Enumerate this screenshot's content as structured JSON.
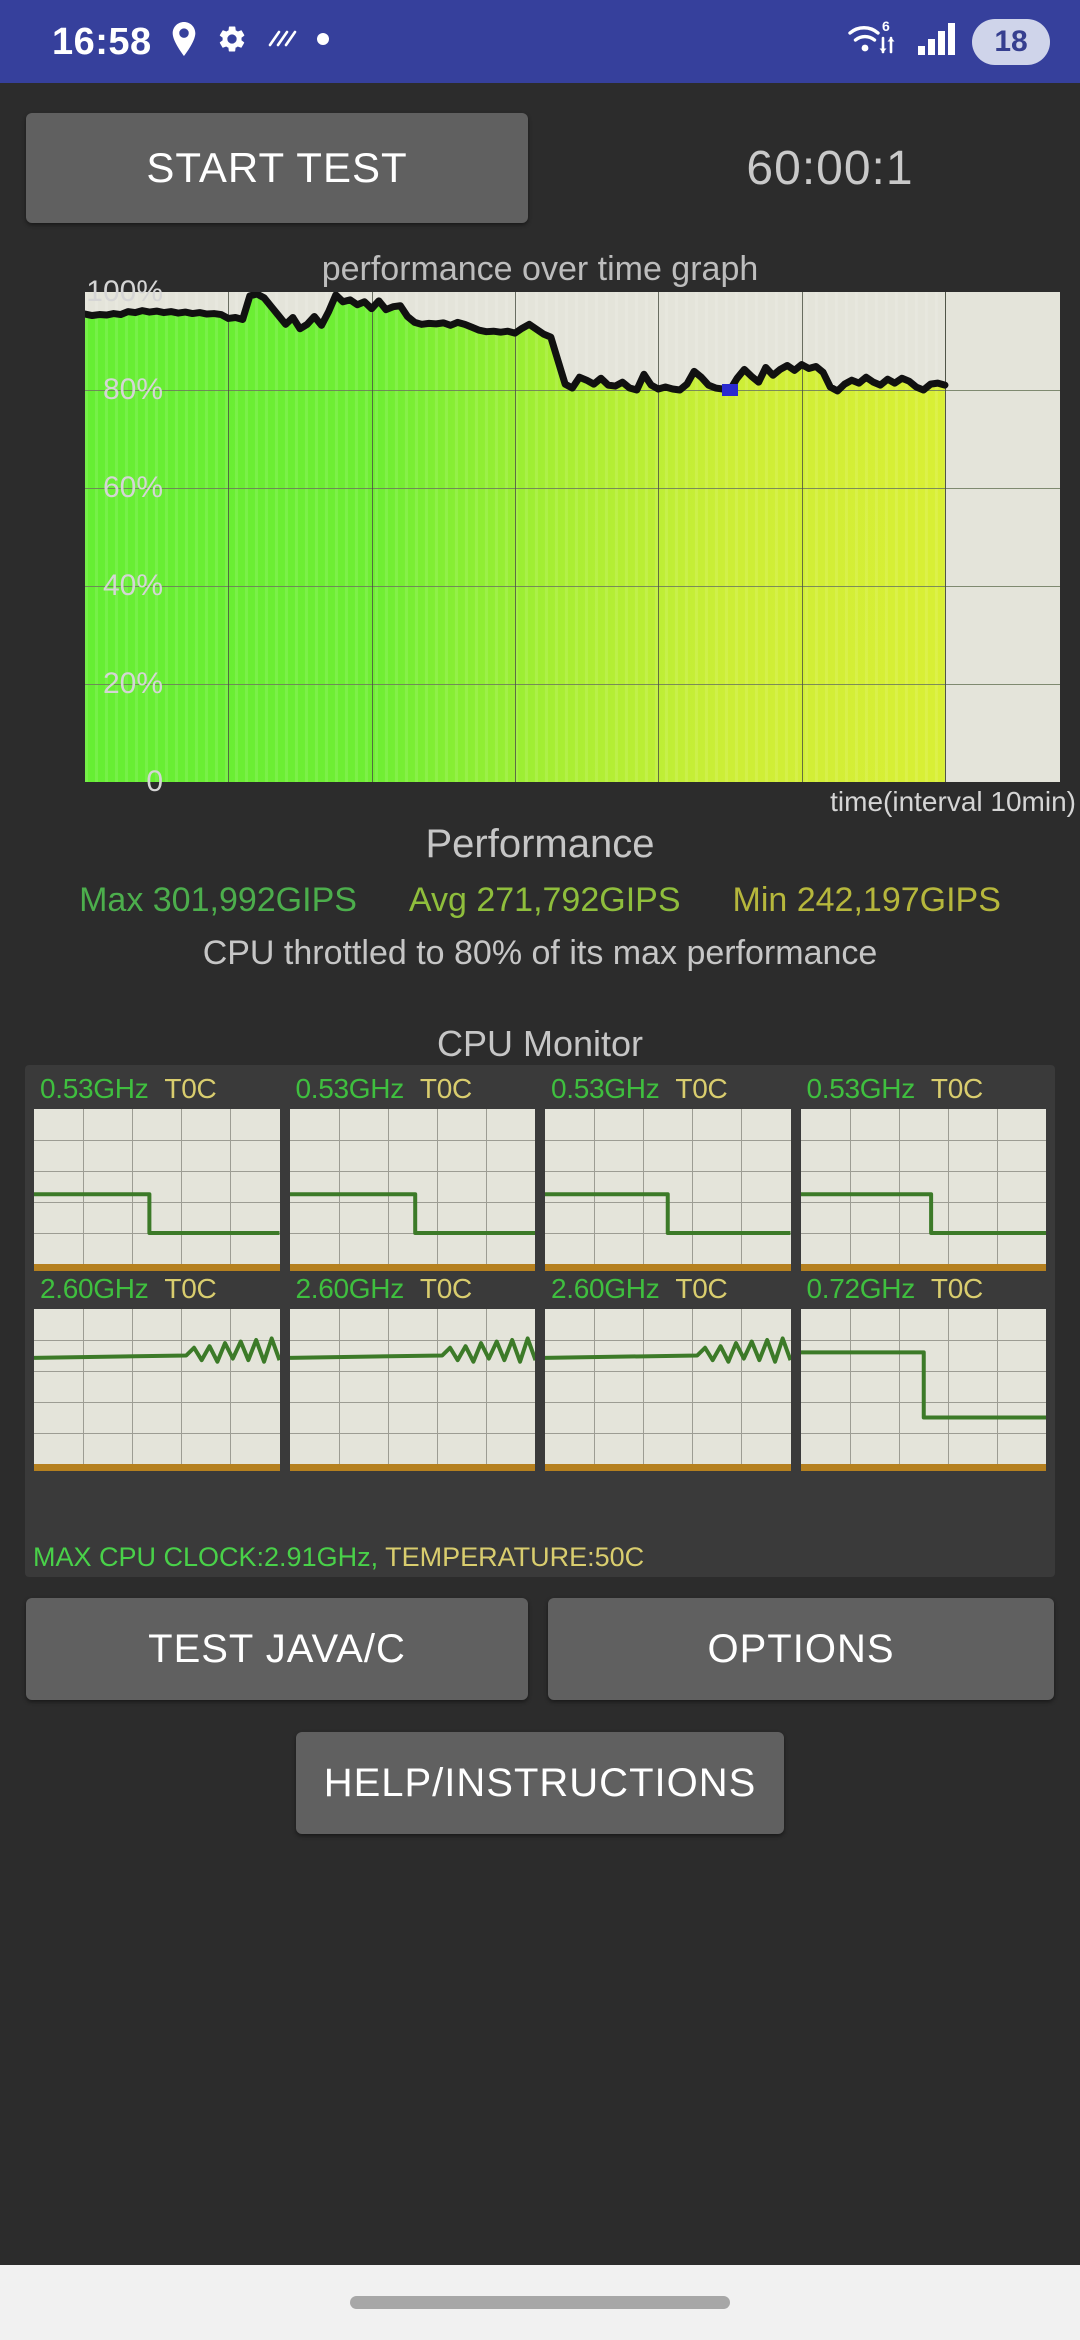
{
  "status_bar": {
    "clock": "16:58",
    "battery_label": "18",
    "left_icons": [
      "location-pin-icon",
      "gear-icon",
      "vpn-key-icon",
      "dot-indicator-icon"
    ],
    "right_icons": [
      "wifi-6-icon",
      "cellular-signal-icon"
    ],
    "background_color": "#36409c"
  },
  "toolbar": {
    "start_test_label": "START TEST",
    "timer_value": "60:00:1"
  },
  "chart_data": {
    "type": "area",
    "title": "performance over time graph",
    "xlabel": "time(interval 10min)",
    "ylabel": "",
    "ylim": [
      0,
      100
    ],
    "xlim": [
      0,
      68
    ],
    "y_ticks": [
      "100%",
      "80%",
      "60%",
      "40%",
      "20%",
      "0"
    ],
    "y_tick_values": [
      100,
      80,
      60,
      40,
      20,
      0
    ],
    "x_gridlines": [
      10,
      20,
      30,
      40,
      50,
      60
    ],
    "grid": true,
    "legend": "none",
    "series_name": "performance",
    "line_color": "#111111",
    "fill_gradient": [
      "#66ee33",
      "#d7ee33"
    ],
    "plot_background": "#e4e4da",
    "marker": {
      "name": "min-point-marker",
      "color": "#2a2ad0",
      "x": 45,
      "y": 80
    },
    "x": [
      0,
      0.5,
      1,
      1.5,
      2,
      2.5,
      3,
      3.5,
      4,
      4.5,
      5,
      5.5,
      6,
      6.5,
      7,
      7.5,
      8,
      8.5,
      9,
      9.5,
      10,
      10.5,
      11,
      11.5,
      12,
      12.5,
      13,
      13.5,
      14,
      14.5,
      15,
      15.5,
      16,
      16.5,
      17,
      17.5,
      18,
      18.5,
      19,
      19.5,
      20,
      20.5,
      21,
      21.5,
      22,
      22.5,
      23,
      23.5,
      24,
      24.5,
      25,
      25.5,
      26,
      26.5,
      27,
      27.5,
      28,
      28.5,
      29,
      29.5,
      30,
      30.5,
      31,
      31.5,
      32,
      32.5,
      33,
      33.5,
      34,
      34.5,
      35,
      35.5,
      36,
      36.5,
      37,
      37.5,
      38,
      38.5,
      39,
      39.5,
      40,
      40.5,
      41,
      41.5,
      42,
      42.5,
      43,
      43.5,
      44,
      44.5,
      45,
      45.5,
      46,
      46.5,
      47,
      47.5,
      48,
      48.5,
      49,
      49.5,
      50,
      50.5,
      51,
      51.5,
      52,
      52.5,
      53,
      53.5,
      54,
      54.5,
      55,
      55.5,
      56,
      56.5,
      57,
      57.5,
      58,
      58.5,
      59,
      59.5,
      60
    ],
    "values": [
      95.5,
      95.2,
      95.4,
      95.3,
      95.6,
      95.4,
      96.0,
      95.8,
      96.2,
      95.9,
      96.1,
      95.8,
      96.0,
      95.7,
      95.9,
      95.6,
      95.8,
      95.5,
      95.6,
      95.4,
      94.6,
      94.8,
      94.4,
      99.2,
      99.6,
      98.8,
      97.0,
      95.2,
      93.4,
      94.8,
      92.5,
      93.4,
      95.0,
      93.2,
      96.0,
      99.4,
      98.0,
      98.4,
      97.4,
      98.0,
      96.6,
      98.2,
      96.4,
      97.0,
      97.2,
      95.0,
      93.8,
      93.4,
      93.6,
      93.5,
      93.7,
      93.2,
      93.8,
      93.4,
      92.8,
      92.2,
      91.9,
      92.0,
      91.8,
      92.0,
      91.6,
      92.6,
      93.4,
      92.4,
      91.4,
      90.8,
      86.0,
      81.2,
      80.4,
      82.6,
      82.0,
      81.2,
      82.4,
      81.0,
      80.8,
      81.6,
      80.4,
      80.0,
      83.2,
      81.0,
      80.2,
      80.6,
      80.2,
      80.0,
      81.2,
      83.8,
      82.6,
      81.0,
      80.4,
      80.2,
      80.0,
      82.4,
      84.2,
      82.8,
      81.6,
      84.6,
      83.0,
      84.2,
      85.0,
      84.0,
      85.2,
      84.4,
      84.8,
      83.6,
      80.6,
      79.8,
      81.2,
      82.0,
      81.4,
      82.6,
      81.6,
      81.0,
      82.2,
      81.4,
      82.4,
      81.8,
      80.6,
      80.0,
      81.2,
      81.4,
      81.0
    ],
    "data_extent_ratio": 0.882
  },
  "performance": {
    "heading": "Performance",
    "max_label": "Max 301,992GIPS",
    "avg_label": "Avg 271,792GIPS",
    "min_label": "Min 242,197GIPS",
    "max_color": "#4cae4c",
    "avg_color": "#8fbe3c",
    "min_color": "#b6b73c",
    "note": "CPU throttled to 80% of its max performance"
  },
  "cpu_monitor": {
    "heading": "CPU Monitor",
    "cores": [
      {
        "name": "core-0",
        "clock": "0.53GHz",
        "temp": "T0C",
        "shape": "step-down-mid",
        "step_x": 0.47,
        "high": 0.55,
        "low": 0.8
      },
      {
        "name": "core-1",
        "clock": "0.53GHz",
        "temp": "T0C",
        "shape": "step-down-mid",
        "step_x": 0.51,
        "high": 0.55,
        "low": 0.8
      },
      {
        "name": "core-2",
        "clock": "0.53GHz",
        "temp": "T0C",
        "shape": "step-down-mid",
        "step_x": 0.5,
        "high": 0.55,
        "low": 0.8
      },
      {
        "name": "core-3",
        "clock": "0.53GHz",
        "temp": "T0C",
        "shape": "step-down-mid",
        "step_x": 0.53,
        "high": 0.55,
        "low": 0.8
      },
      {
        "name": "core-4",
        "clock": "2.60GHz",
        "temp": "T0C",
        "shape": "flat-then-wave",
        "wave_start": 0.62,
        "level": 0.3
      },
      {
        "name": "core-5",
        "clock": "2.60GHz",
        "temp": "T0C",
        "shape": "flat-then-wave",
        "wave_start": 0.62,
        "level": 0.3
      },
      {
        "name": "core-6",
        "clock": "2.60GHz",
        "temp": "T0C",
        "shape": "flat-then-wave",
        "wave_start": 0.62,
        "level": 0.3
      },
      {
        "name": "core-7",
        "clock": "0.72GHz",
        "temp": "T0C",
        "shape": "step-down-mid",
        "step_x": 0.5,
        "high": 0.28,
        "low": 0.7
      }
    ],
    "line_color": "#3c7a28",
    "temp_bar_color": "#b5801f",
    "graph_background": "#e4e4da",
    "footer_clock": "MAX CPU CLOCK:2.91GHz,",
    "footer_temp": "TEMPERATURE:50C"
  },
  "bottom_buttons": {
    "test_java_c": "TEST JAVA/C",
    "options": "OPTIONS",
    "help_instructions": "HELP/INSTRUCTIONS"
  },
  "nav_bar": {
    "handle": "gesture-pill"
  }
}
